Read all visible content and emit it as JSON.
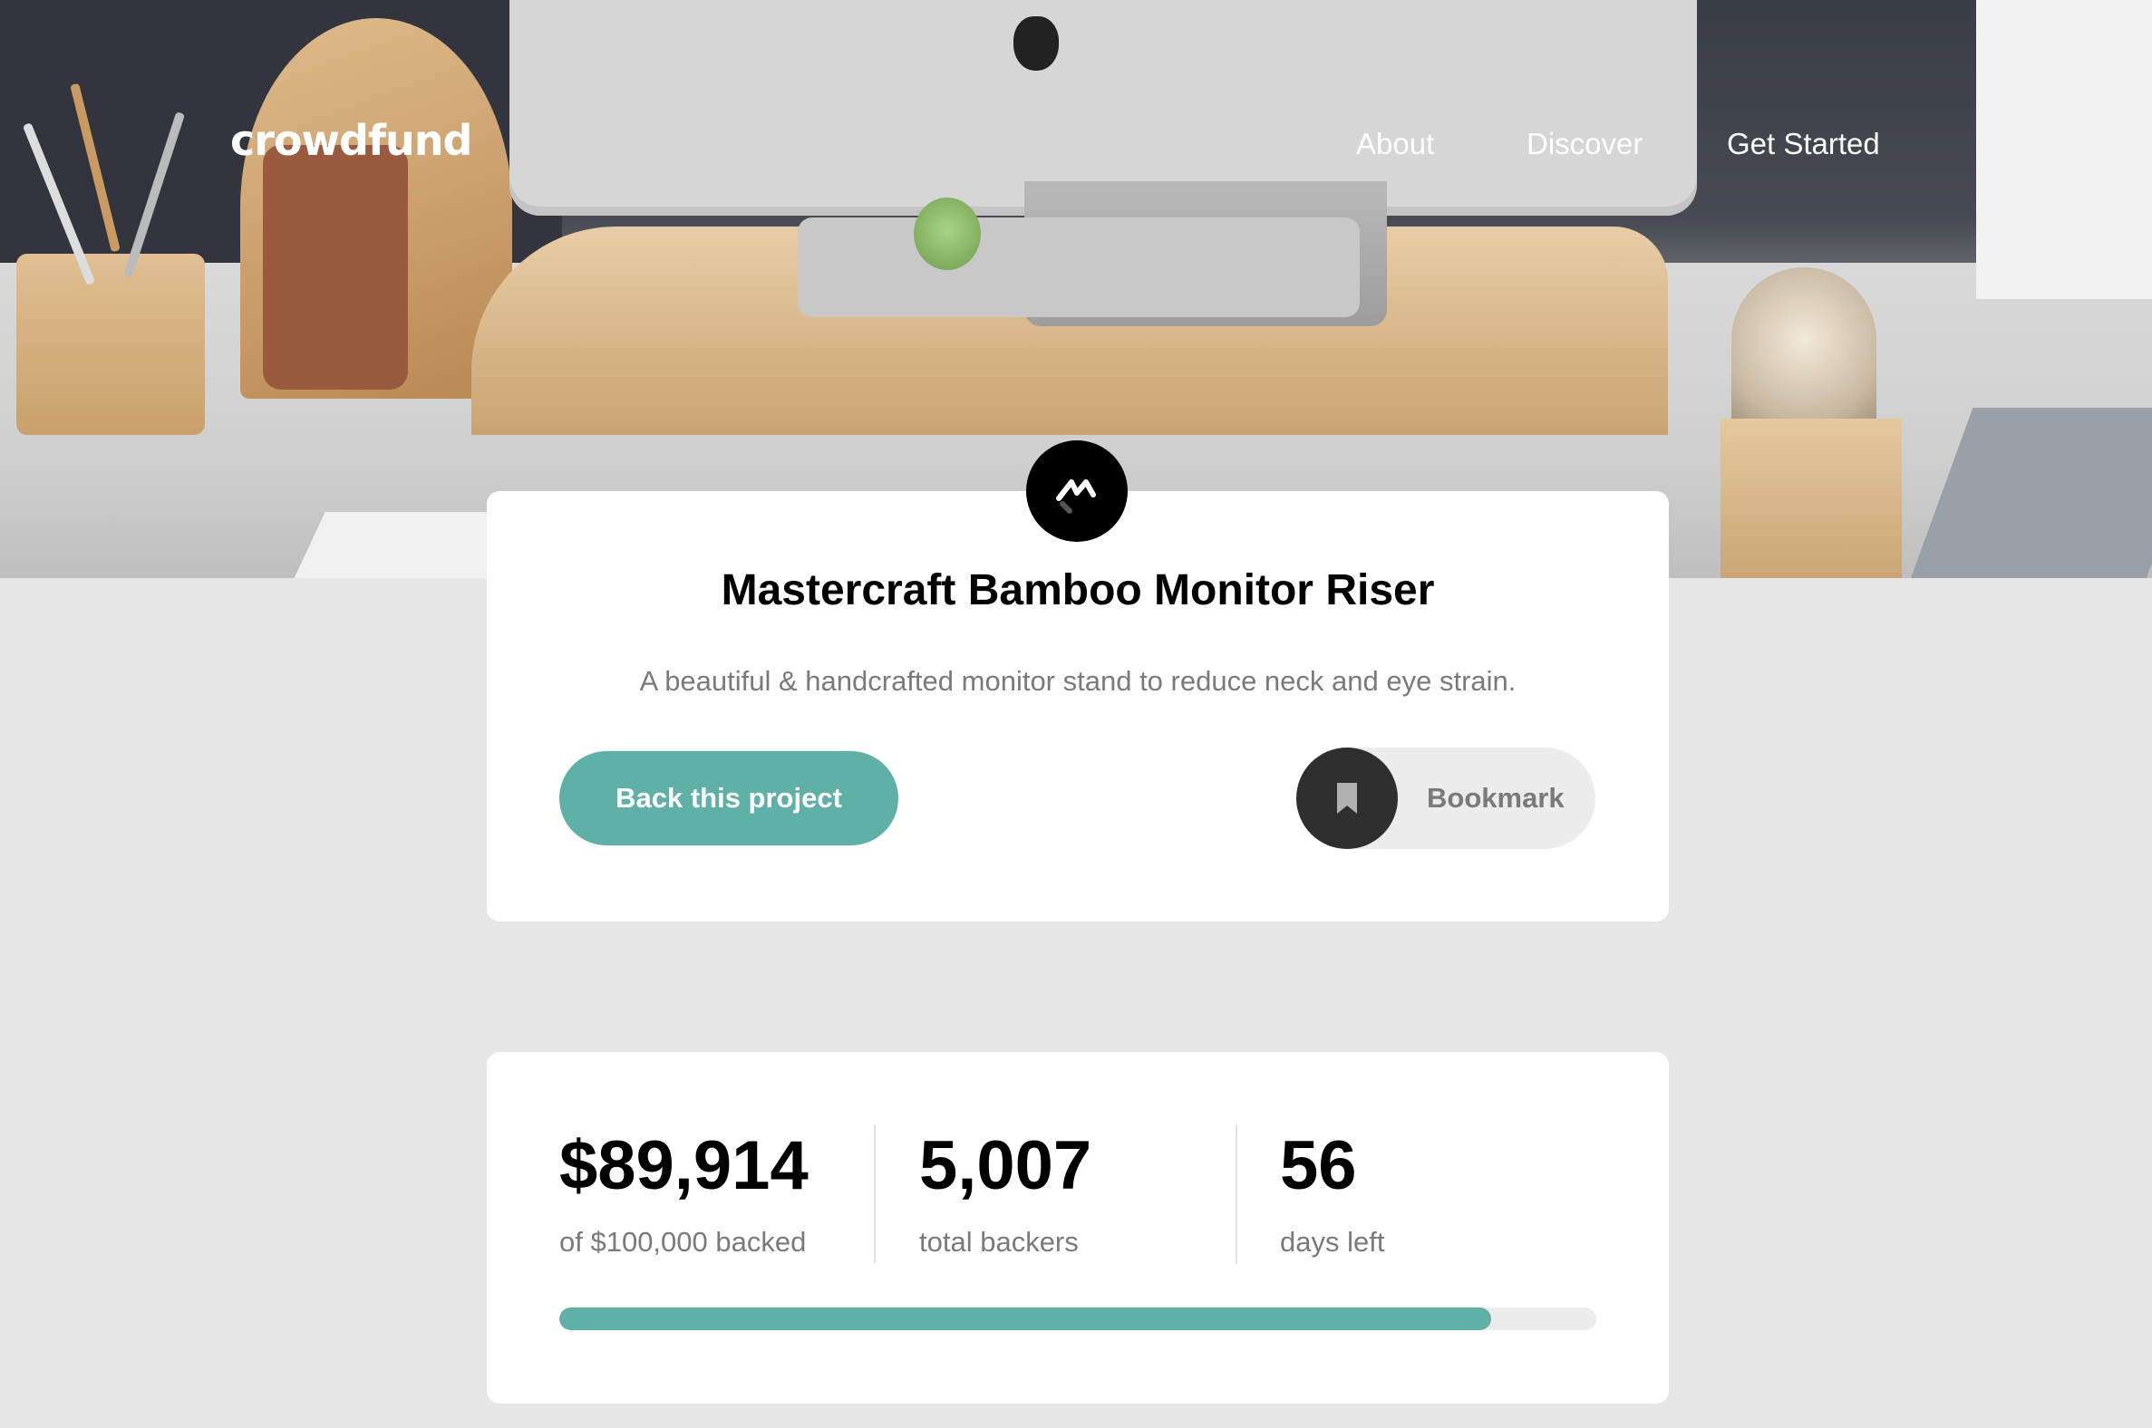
{
  "brand": {
    "logo_text": "crowdfund"
  },
  "nav": {
    "links": [
      {
        "label": "About"
      },
      {
        "label": "Discover"
      },
      {
        "label": "Get Started"
      }
    ]
  },
  "hero": {
    "image": "desk-with-monitor-on-bamboo-riser"
  },
  "project": {
    "logo_icon": "mastercraft-logo-icon",
    "title": "Mastercraft Bamboo Monitor Riser",
    "description": "A beautiful & handcrafted monitor stand to reduce neck and eye strain.",
    "back_button_label": "Back this project",
    "bookmark_label": "Bookmark",
    "bookmark_icon": "bookmark-icon"
  },
  "stats": {
    "backed_amount": "$89,914",
    "backed_label": "of $100,000 backed",
    "backers_count": "5,007",
    "backers_label": "total backers",
    "days_left": "56",
    "days_label": "days left",
    "progress_fraction": 0.899
  },
  "colors": {
    "accent": "#5fb0a7",
    "background": "#e6e6e6",
    "card": "#ffffff",
    "muted_text": "#7a7a7a"
  }
}
